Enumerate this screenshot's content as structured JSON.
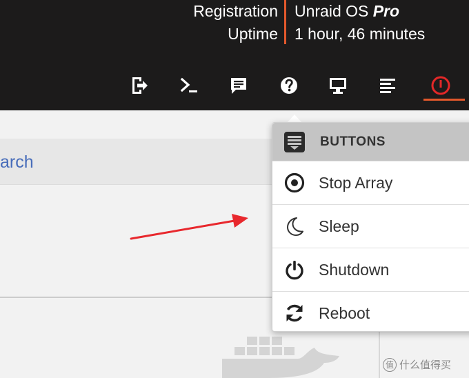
{
  "header": {
    "registration_label": "Registration",
    "registration_value_prefix": "Unraid OS ",
    "registration_value_tier": "Pro",
    "uptime_label": "Uptime",
    "uptime_value": "1 hour, 46 minutes",
    "accent_color": "#e2582c",
    "toolbar_icons": [
      "logout-icon",
      "terminal-icon",
      "feedback-icon",
      "help-icon",
      "monitor-icon",
      "log-icon",
      "power-icon"
    ]
  },
  "background": {
    "search_link_text": "arch"
  },
  "dropdown": {
    "header_label": "BUTTONS",
    "items": [
      {
        "label": "Stop Array",
        "icon": "stop-array-icon"
      },
      {
        "label": "Sleep",
        "icon": "moon-icon"
      },
      {
        "label": "Shutdown",
        "icon": "power-icon"
      },
      {
        "label": "Reboot",
        "icon": "reboot-icon"
      }
    ]
  },
  "watermark": {
    "text": "什么值得买",
    "mark": "值"
  }
}
